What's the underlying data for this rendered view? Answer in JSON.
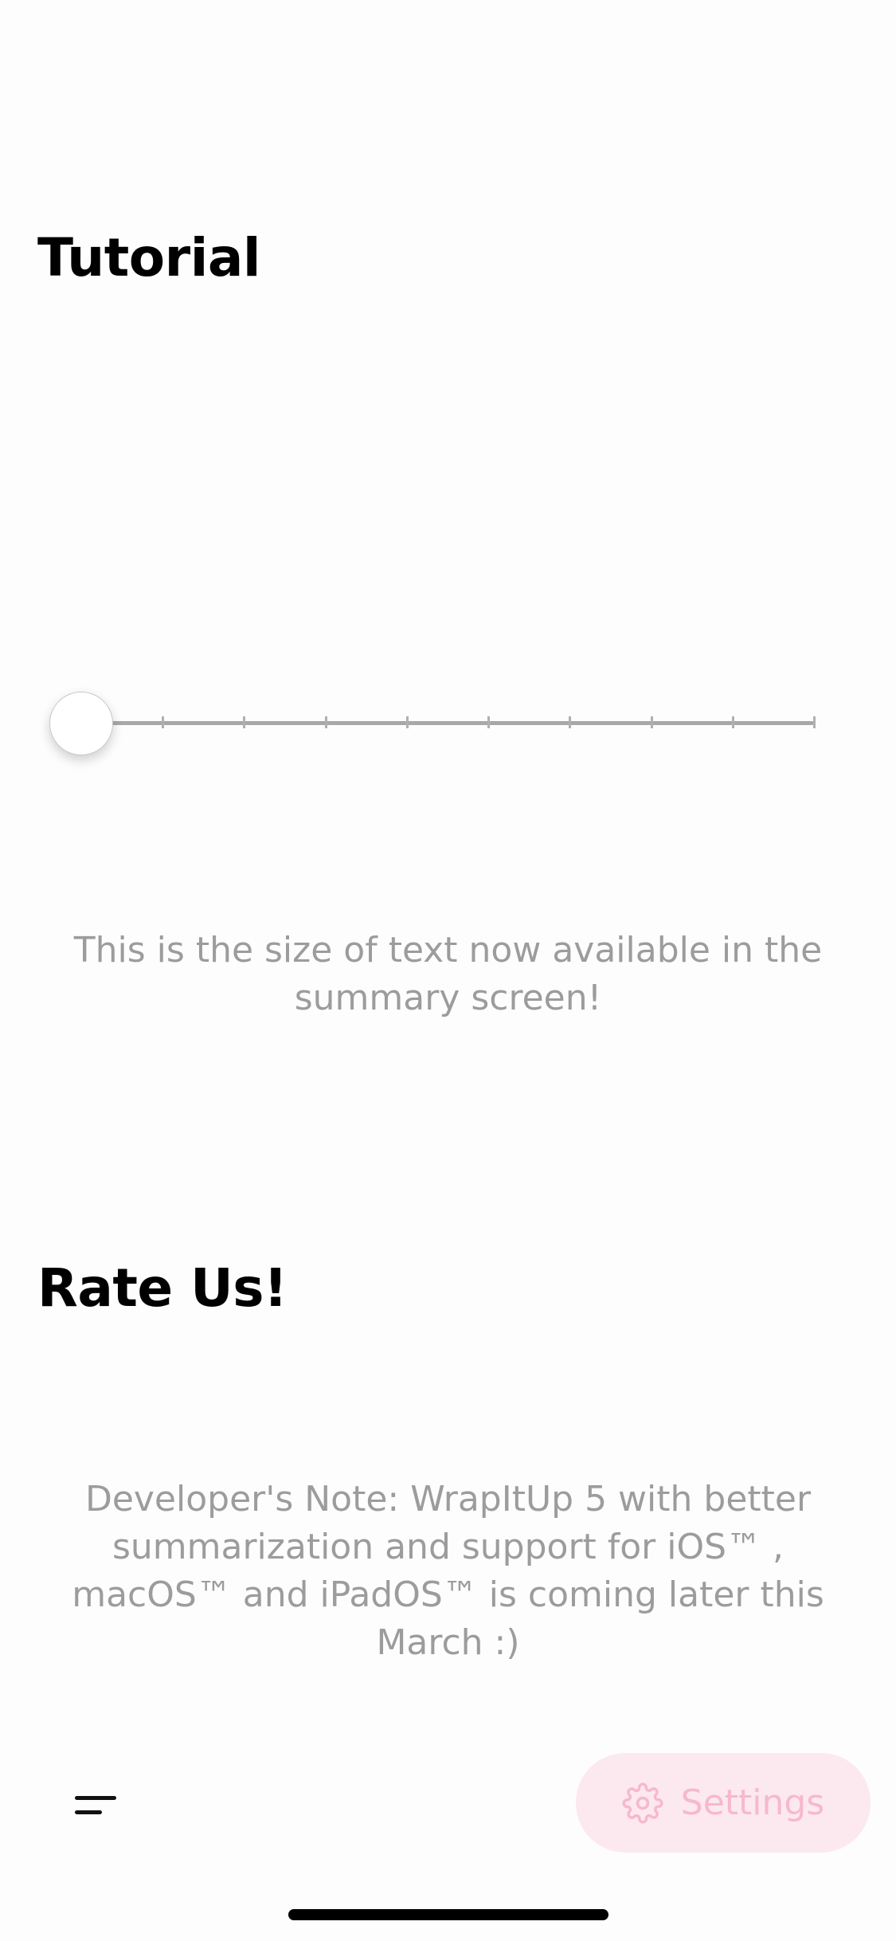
{
  "sections": {
    "tutorial_title": "Tutorial",
    "rate_title": "Rate Us!"
  },
  "text_size_slider": {
    "value_fraction": 0,
    "steps": 9
  },
  "size_preview_text": "This is the size of text now available in the summary screen!",
  "developer_note": "Developer's Note: WrapItUp 5 with better summarization and support for iOS™ , macOS™ and iPadOS™ is coming later this March :)",
  "bottom_bar": {
    "menu_icon": "hamburger-menu-icon",
    "settings_icon": "gear-icon",
    "settings_label": "Settings"
  },
  "colors": {
    "settings_bg": "#fce9ef",
    "settings_fg": "#f7b8cd",
    "muted_text": "#9c9c9c"
  }
}
